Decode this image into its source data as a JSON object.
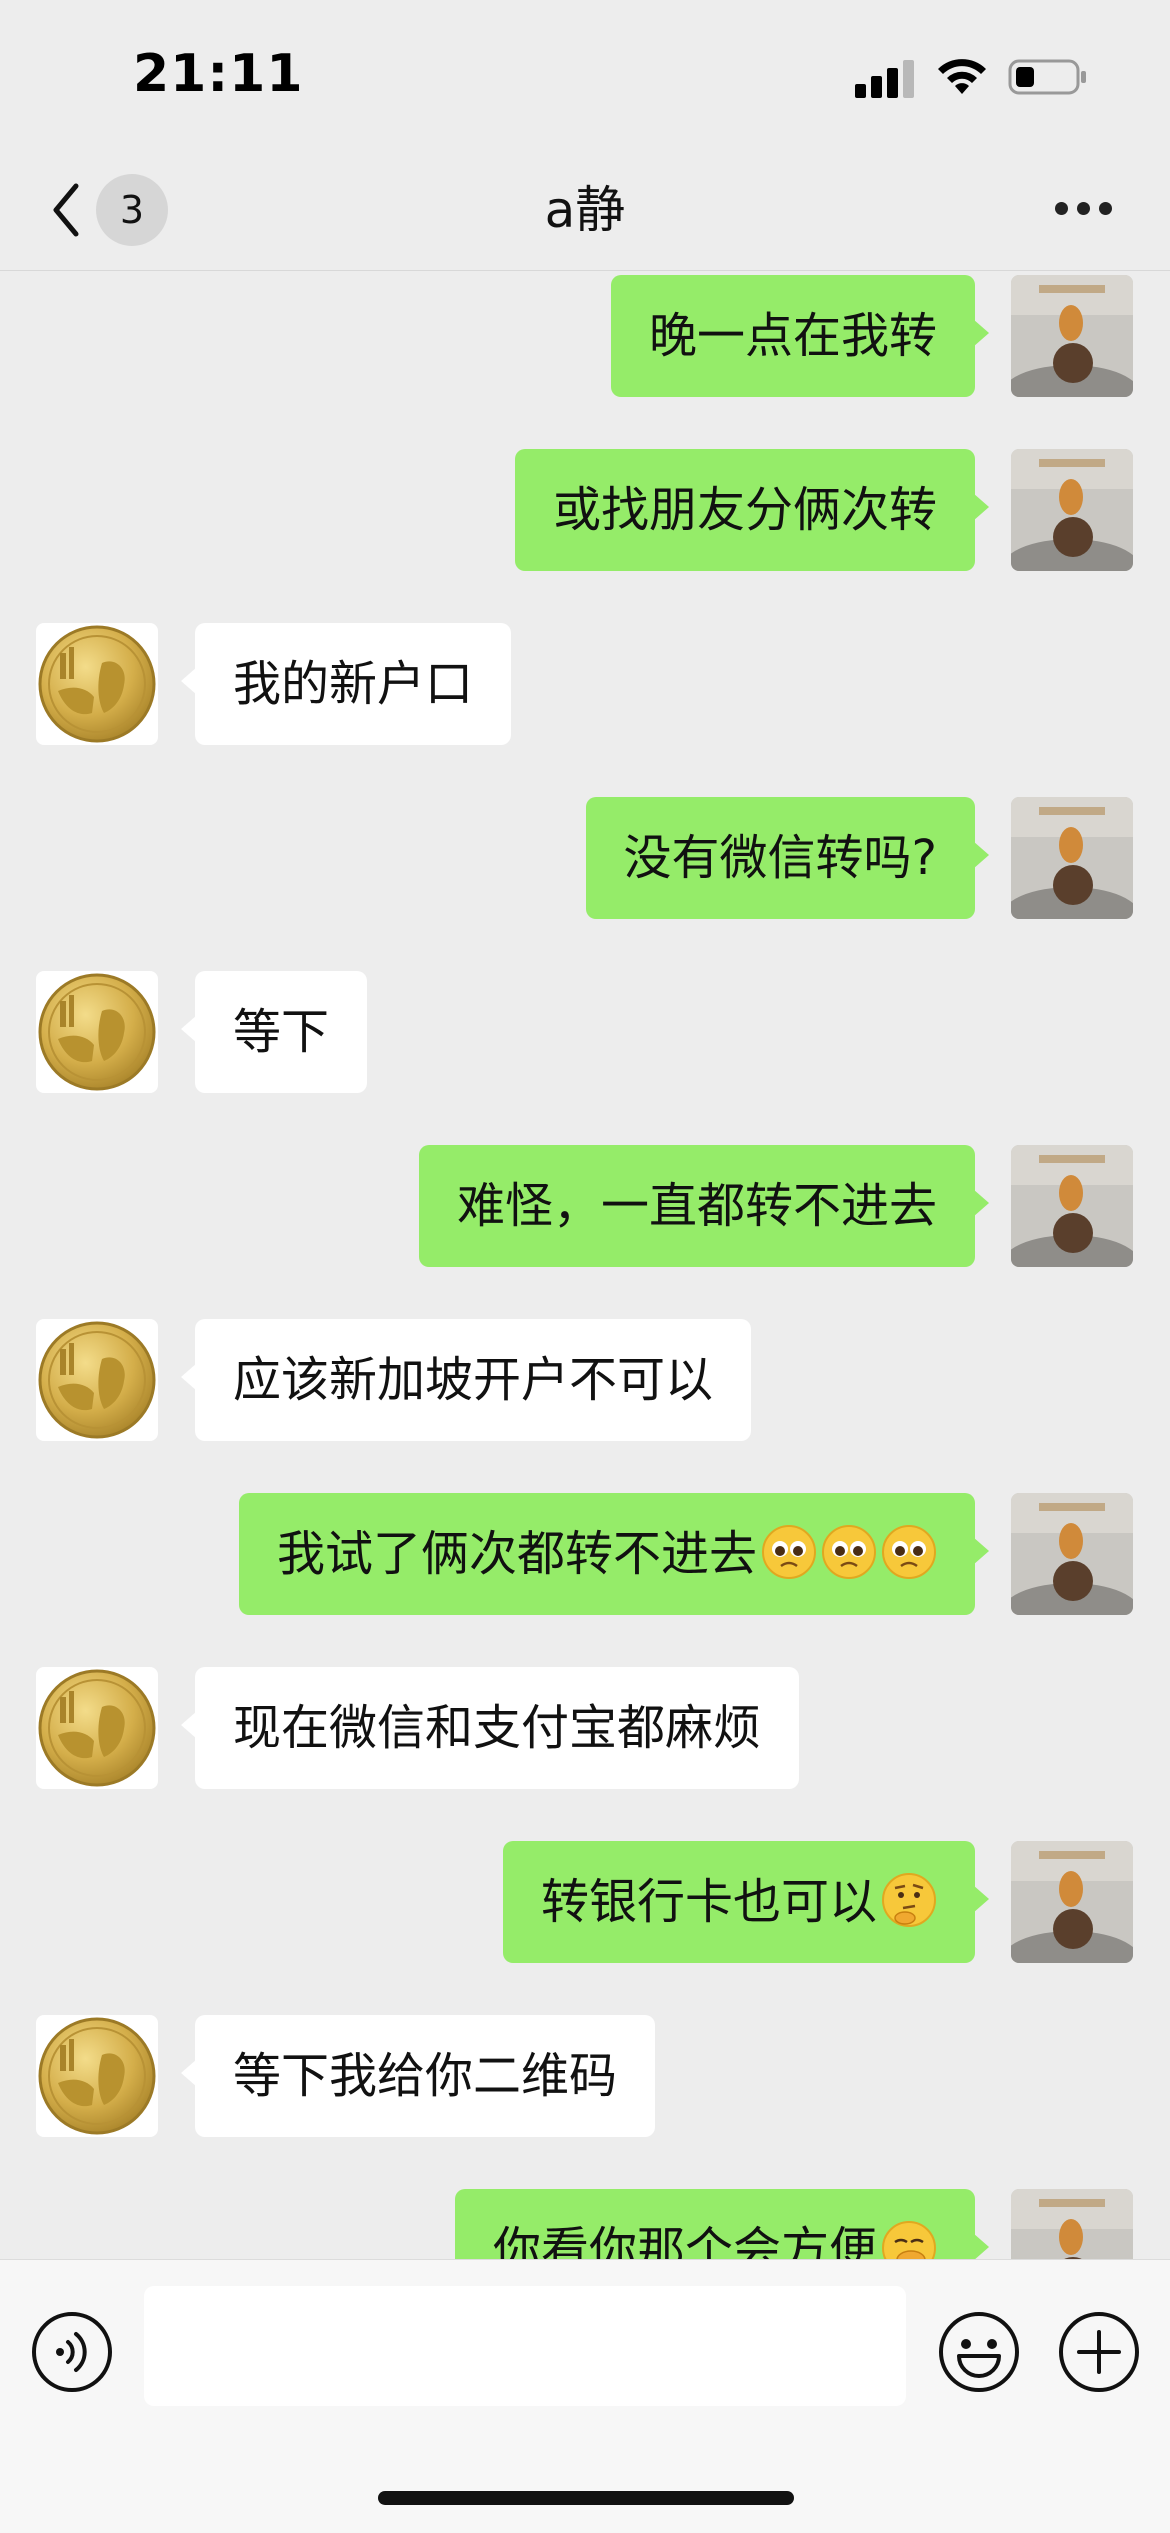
{
  "status_bar": {
    "time": "21:11"
  },
  "header": {
    "back_badge": "3",
    "title": "a静"
  },
  "messages": [
    {
      "from": "me",
      "text": "晚一点在我转"
    },
    {
      "from": "me",
      "text": "或找朋友分俩次转"
    },
    {
      "from": "contact",
      "text": "我的新户口"
    },
    {
      "from": "me",
      "text": "没有微信转吗?"
    },
    {
      "from": "contact",
      "text": "等下"
    },
    {
      "from": "me",
      "text": "难怪，一直都转不进去"
    },
    {
      "from": "contact",
      "text": "应该新加坡开户不可以"
    },
    {
      "from": "me",
      "text": "我试了俩次都转不进去",
      "emojis": [
        "pleading-face",
        "pleading-face",
        "pleading-face"
      ]
    },
    {
      "from": "contact",
      "text": "现在微信和支付宝都麻烦"
    },
    {
      "from": "me",
      "text": "转银行卡也可以",
      "emojis": [
        "thinking-face"
      ]
    },
    {
      "from": "contact",
      "text": "等下我给你二维码"
    },
    {
      "from": "me",
      "text": "你看你那个会方便",
      "emojis": [
        "hand-over-mouth-face"
      ]
    }
  ],
  "input_bar": {
    "value": ""
  },
  "icons": {
    "back": "chevron-left-icon",
    "more": "more-dots-icon",
    "voice": "voice-icon",
    "emoji": "smile-icon",
    "plus": "plus-icon"
  },
  "colors": {
    "outgoing_bubble": "#95ec69",
    "incoming_bubble": "#ffffff",
    "background": "#ededed"
  }
}
